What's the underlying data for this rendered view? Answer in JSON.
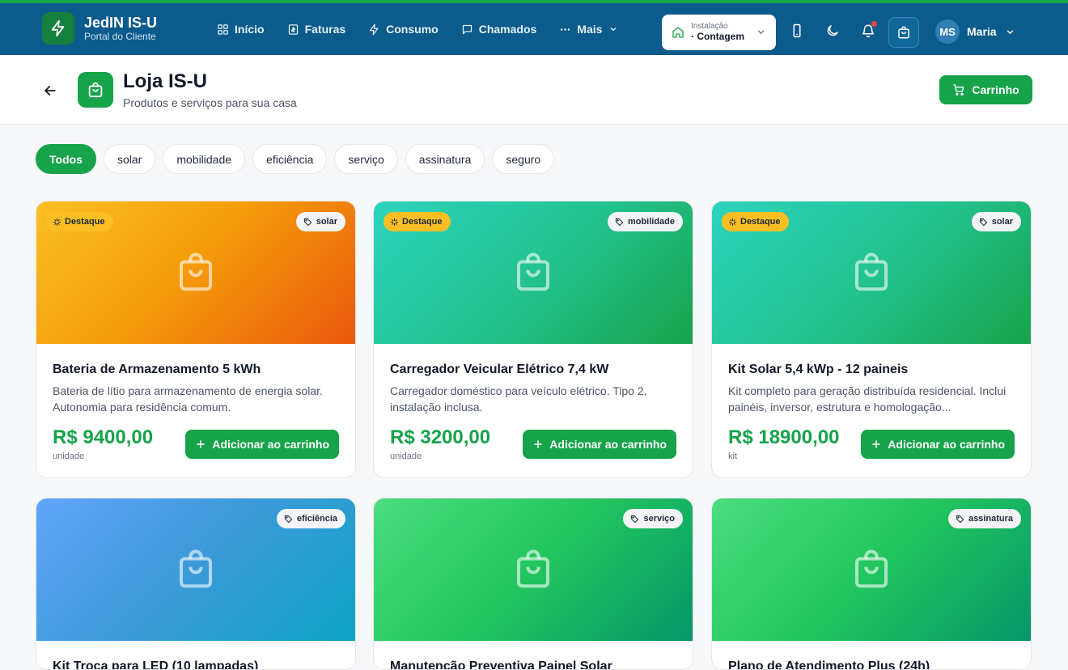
{
  "brand": {
    "name": "JedIN IS-U",
    "subtitle": "Portal do Cliente"
  },
  "nav": [
    {
      "label": "Início",
      "icon": "grid-icon"
    },
    {
      "label": "Faturas",
      "icon": "invoice-icon"
    },
    {
      "label": "Consumo",
      "icon": "bolt-icon"
    },
    {
      "label": "Chamados",
      "icon": "chat-icon"
    },
    {
      "label": "Mais",
      "icon": "more-icon"
    }
  ],
  "installation": {
    "label": "Instalação",
    "value": "· Contagem"
  },
  "user": {
    "initials": "MS",
    "name": "Maria"
  },
  "page": {
    "title": "Loja IS-U",
    "subtitle": "Produtos e serviços para sua casa",
    "cart_label": "Carrinho"
  },
  "filters": [
    "Todos",
    "solar",
    "mobilidade",
    "eficiência",
    "serviço",
    "assinatura",
    "seguro"
  ],
  "active_filter": "Todos",
  "featured_label": "Destaque",
  "add_label": "Adicionar ao carrinho",
  "products": [
    {
      "category": "solar",
      "featured": true,
      "title": "Bateria de Armazenamento 5 kWh",
      "desc": "Bateria de lítio para armazenamento de energia solar. Autonomia para residência comum.",
      "price": "R$ 9400,00",
      "unit": "unidade",
      "gradient": "orange"
    },
    {
      "category": "mobilidade",
      "featured": true,
      "title": "Carregador Veicular Elétrico 7,4 kW",
      "desc": "Carregador doméstico para veículo elétrico. Tipo 2, instalação inclusa.",
      "price": "R$ 3200,00",
      "unit": "unidade",
      "gradient": "teal"
    },
    {
      "category": "solar",
      "featured": true,
      "title": "Kit Solar 5,4 kWp - 12 paineis",
      "desc": "Kit completo para geração distribuída residencial. Inclui painéis, inversor, estrutura e homologação...",
      "price": "R$ 18900,00",
      "unit": "kit",
      "gradient": "teal"
    },
    {
      "category": "eficiência",
      "featured": false,
      "title": "Kit Troca para LED (10 lampadas)",
      "desc": "",
      "price": "",
      "unit": "",
      "gradient": "blue"
    },
    {
      "category": "serviço",
      "featured": false,
      "title": "Manutenção Preventiva Painel Solar",
      "desc": "",
      "price": "",
      "unit": "",
      "gradient": "green"
    },
    {
      "category": "assinatura",
      "featured": false,
      "title": "Plano de Atendimento Plus (24h)",
      "desc": "",
      "price": "",
      "unit": "",
      "gradient": "green"
    }
  ],
  "colors": {
    "topbar": "#0b5b8c",
    "accent": "#16a34a",
    "featured_badge": "#fbbf24",
    "notification": "#ef4444"
  }
}
